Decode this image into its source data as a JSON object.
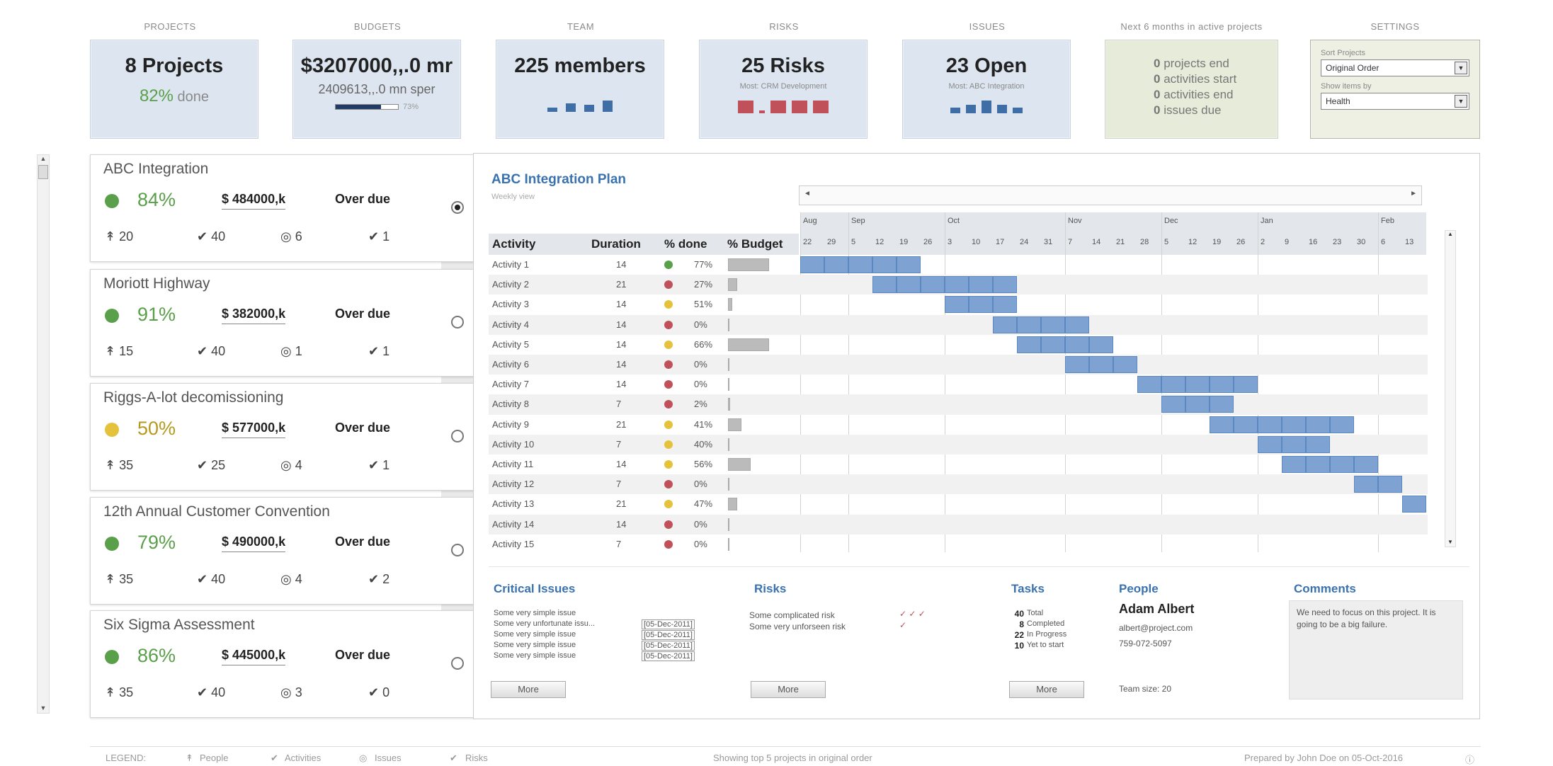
{
  "kpis": [
    {
      "label": "PROJECTS",
      "big": "8 Projects",
      "pct": "82%",
      "sub": "done"
    },
    {
      "label": "BUDGETS",
      "big": "$3207000,,.0 mr",
      "sub": "2409613,,.0 mn sper",
      "bar_pct": "73%"
    },
    {
      "label": "TEAM",
      "big": "225 members"
    },
    {
      "label": "RISKS",
      "big": "25 Risks",
      "sub": "Most: CRM Development"
    },
    {
      "label": "ISSUES",
      "big": "23 Open",
      "sub": "Most: ABC Integration"
    },
    {
      "label": "Next 6 months in active projects",
      "items": [
        "projects end",
        "activities start",
        "activities end",
        "issues due"
      ],
      "counts": [
        "0",
        "0",
        "0",
        "0"
      ]
    },
    {
      "label": "SETTINGS",
      "sort_label": "Sort Projects",
      "sort_value": "Original Order",
      "show_label": "Show items by",
      "show_value": "Health"
    }
  ],
  "projects": [
    {
      "title": "ABC Integration",
      "pct": "84%",
      "budget": "$ 484000,k",
      "overdue": "Over due",
      "people": "20",
      "activities": "40",
      "issues": "6",
      "risks": "1",
      "health": "#5aa04a",
      "selected": true
    },
    {
      "title": "Moriott Highway",
      "pct": "91%",
      "budget": "$ 382000,k",
      "overdue": "Over due",
      "people": "15",
      "activities": "40",
      "issues": "1",
      "risks": "1",
      "health": "#5aa04a"
    },
    {
      "title": "Riggs-A-lot decomissioning",
      "pct": "50%",
      "budget": "$ 577000,k",
      "overdue": "Over due",
      "people": "35",
      "activities": "25",
      "issues": "4",
      "risks": "1",
      "health": "#e4c23c"
    },
    {
      "title": "12th Annual Customer Convention",
      "pct": "79%",
      "budget": "$ 490000,k",
      "overdue": "Over due",
      "people": "35",
      "activities": "40",
      "issues": "4",
      "risks": "2",
      "health": "#5aa04a"
    },
    {
      "title": "Six Sigma Assessment",
      "pct": "86%",
      "budget": "$ 445000,k",
      "overdue": "Over due",
      "people": "35",
      "activities": "40",
      "issues": "3",
      "risks": "0",
      "health": "#5aa04a"
    }
  ],
  "plan": {
    "title": "ABC Integration Plan",
    "subtitle": "Weekly view",
    "headers": [
      "Activity",
      "Duration",
      "% done",
      "% Budget"
    ],
    "months": [
      "Aug",
      "Sep",
      "Oct",
      "Nov",
      "Dec",
      "Jan",
      "Feb"
    ],
    "days": [
      "22",
      "29",
      "5",
      "12",
      "19",
      "26",
      "3",
      "10",
      "17",
      "24",
      "31",
      "7",
      "14",
      "21",
      "28",
      "5",
      "12",
      "19",
      "26",
      "2",
      "9",
      "16",
      "23",
      "30",
      "6",
      "13"
    ],
    "activities": [
      {
        "name": "Activity 1",
        "dur": "14",
        "done": "77%",
        "status": "#5aa04a",
        "budget": 0.9,
        "start": 0,
        "len": 5
      },
      {
        "name": "Activity 2",
        "dur": "21",
        "done": "27%",
        "status": "#c0505a",
        "budget": 0.2,
        "start": 3,
        "len": 6
      },
      {
        "name": "Activity 3",
        "dur": "14",
        "done": "51%",
        "status": "#e4c23c",
        "budget": 0.1,
        "start": 6,
        "len": 3
      },
      {
        "name": "Activity 4",
        "dur": "14",
        "done": "0%",
        "status": "#c0505a",
        "budget": 0,
        "start": 8,
        "len": 4
      },
      {
        "name": "Activity 5",
        "dur": "14",
        "done": "66%",
        "status": "#e4c23c",
        "budget": 0.9,
        "start": 9,
        "len": 4
      },
      {
        "name": "Activity 6",
        "dur": "14",
        "done": "0%",
        "status": "#c0505a",
        "budget": 0,
        "start": 11,
        "len": 3
      },
      {
        "name": "Activity 7",
        "dur": "14",
        "done": "0%",
        "status": "#c0505a",
        "budget": 0,
        "start": 14,
        "len": 5
      },
      {
        "name": "Activity 8",
        "dur": "7",
        "done": "2%",
        "status": "#c0505a",
        "budget": 0.05,
        "start": 15,
        "len": 3
      },
      {
        "name": "Activity 9",
        "dur": "21",
        "done": "41%",
        "status": "#e4c23c",
        "budget": 0.3,
        "start": 17,
        "len": 6
      },
      {
        "name": "Activity 10",
        "dur": "7",
        "done": "40%",
        "status": "#e4c23c",
        "budget": 0,
        "start": 19,
        "len": 3
      },
      {
        "name": "Activity 11",
        "dur": "14",
        "done": "56%",
        "status": "#e4c23c",
        "budget": 0.5,
        "start": 20,
        "len": 4
      },
      {
        "name": "Activity 12",
        "dur": "7",
        "done": "0%",
        "status": "#c0505a",
        "budget": 0,
        "start": 23,
        "len": 2
      },
      {
        "name": "Activity 13",
        "dur": "21",
        "done": "47%",
        "status": "#e4c23c",
        "budget": 0.2,
        "start": 25,
        "len": 1
      },
      {
        "name": "Activity 14",
        "dur": "14",
        "done": "0%",
        "status": "#c0505a",
        "budget": 0,
        "start": -1,
        "len": 0
      },
      {
        "name": "Activity 15",
        "dur": "7",
        "done": "0%",
        "status": "#c0505a",
        "budget": 0,
        "start": -1,
        "len": 0
      }
    ]
  },
  "critical": {
    "title": "Critical Issues",
    "items": [
      "Some very simple issue",
      "Some very unfortunate issu...",
      "Some very simple issue",
      "Some very simple issue",
      "Some very simple issue"
    ],
    "dates": [
      "",
      "[05-Dec-2011]",
      "[05-Dec-2011]",
      "[05-Dec-2011]",
      "[05-Dec-2011]"
    ],
    "more": "More"
  },
  "risks": {
    "title": "Risks",
    "items": [
      "Some complicated risk",
      "Some very unforseen risk"
    ],
    "more": "More"
  },
  "tasks": {
    "title": "Tasks",
    "lines": [
      {
        "n": "40",
        "t": "Total"
      },
      {
        "n": "8",
        "t": "Completed"
      },
      {
        "n": "22",
        "t": "In Progress"
      },
      {
        "n": "10",
        "t": "Yet to start"
      }
    ],
    "more": "More"
  },
  "people": {
    "title": "People",
    "name": "Adam Albert",
    "email": "albert@project.com",
    "phone": "759-072-5097",
    "team": "Team size: 20"
  },
  "comments": {
    "title": "Comments",
    "text": "We need to focus on this project. It is going to be a big failure."
  },
  "footer": {
    "legend": "LEGEND:",
    "people": "People",
    "activities": "Activities",
    "issues": "Issues",
    "risks": "Risks",
    "showing": "Showing top 5 projects in original order",
    "prepared": "Prepared by John Doe on 05-Oct-2016"
  },
  "colors": {
    "accent": "#3a72b0",
    "bar": "#7ea3d3",
    "green": "#5aa04a",
    "yellow": "#e4c23c",
    "red": "#c0505a"
  }
}
